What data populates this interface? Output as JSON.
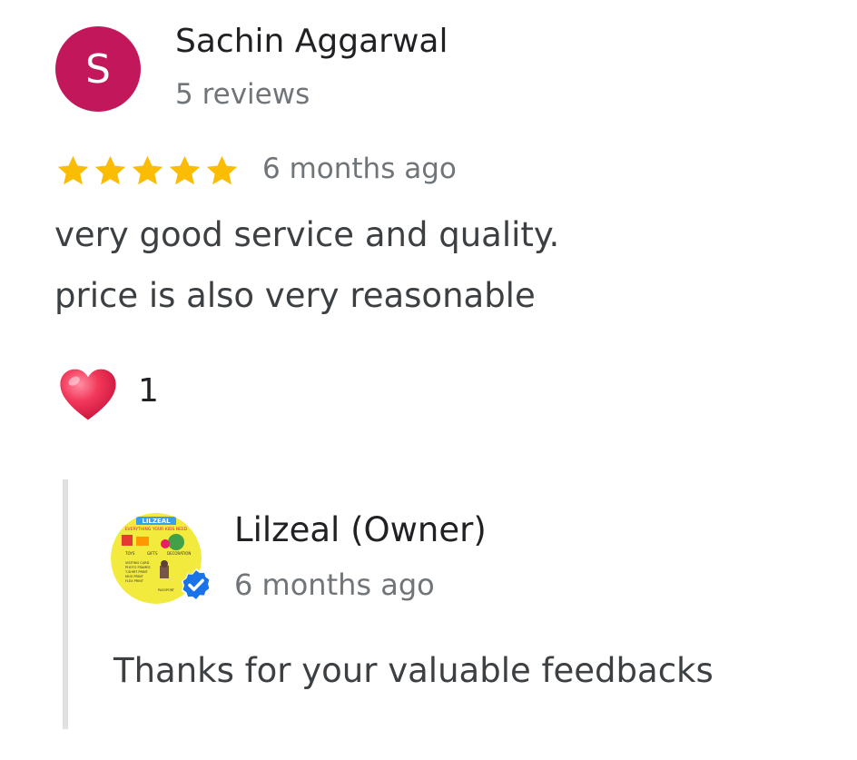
{
  "review": {
    "avatar_letter": "S",
    "avatar_color": "#c2185b",
    "reviewer_name": "Sachin Aggarwal",
    "review_count": "5 reviews",
    "rating": 5,
    "rating_max": 5,
    "star_color": "#fbbc04",
    "date": "6 months ago",
    "text_lines": [
      "very good service and quality.",
      "price is also very reasonable"
    ],
    "reaction_icon": "heart-icon",
    "reaction_count": "1"
  },
  "owner_reply": {
    "name": "Lilzeal (Owner)",
    "date": "6 months ago",
    "text": "Thanks for your valuable feedbacks",
    "verified_icon": "verified-badge-icon",
    "verified_color": "#1a73e8",
    "logo": {
      "title": "LILZEAL",
      "subtitle": "EVERYTHING YOUR KIDS NEED",
      "categories": [
        "TOYS",
        "GIFTS",
        "DECORATION"
      ],
      "services": [
        "VISITING CARD",
        "PHOTO FRAMES",
        "T-SHIRT PRINT",
        "MUG PRINT",
        "FLEX PRINT",
        "PASSPORT"
      ]
    }
  }
}
